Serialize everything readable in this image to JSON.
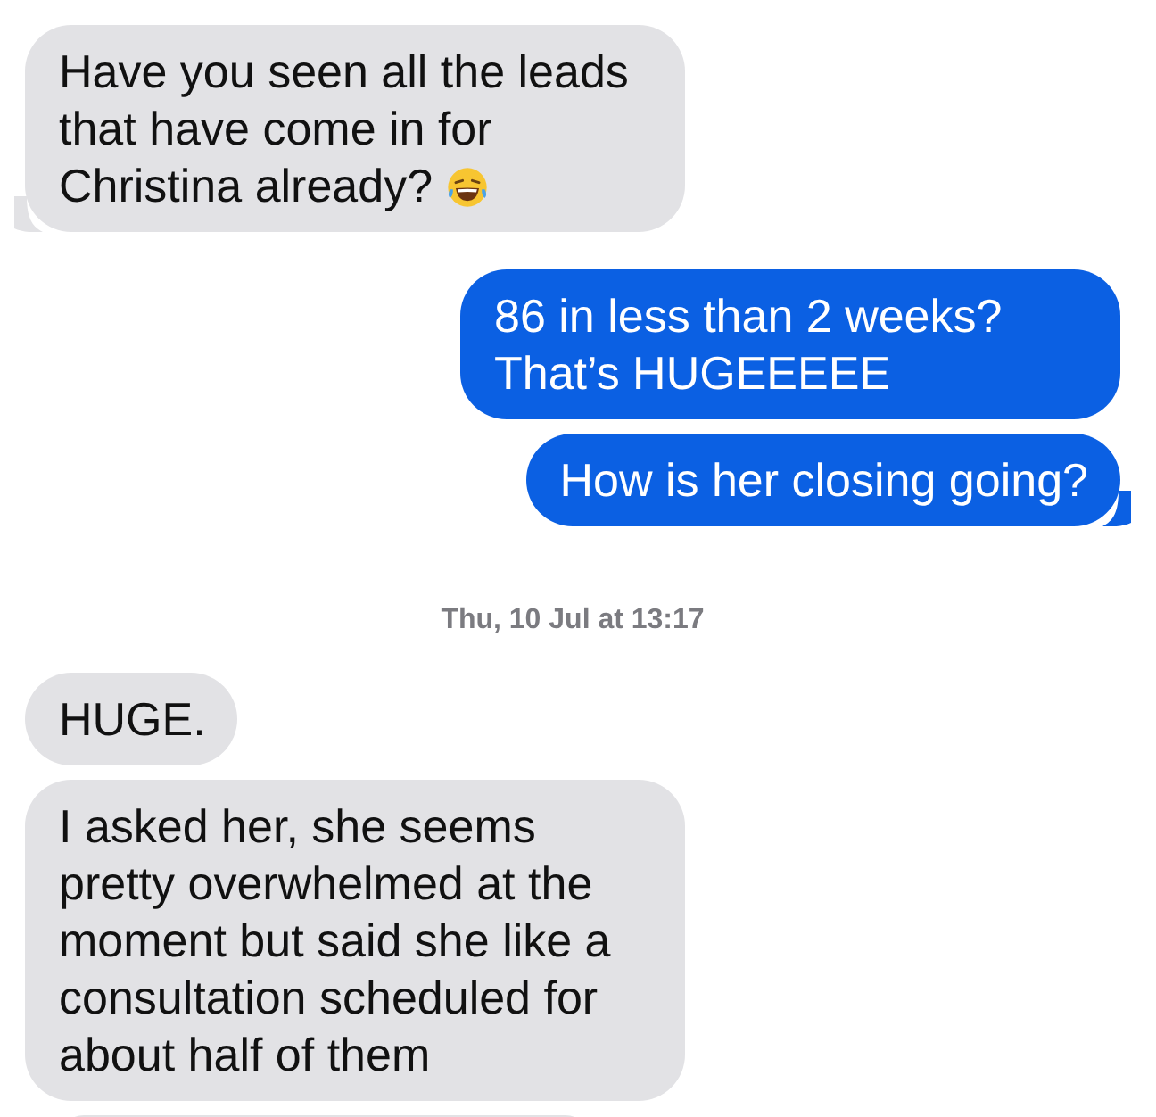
{
  "items": [
    {
      "kind": "message",
      "outgoing": false,
      "text": "Have you seen all the leads that have come in for Christina already?",
      "emoji": true,
      "tail": true
    },
    {
      "kind": "message",
      "outgoing": true,
      "text": "86 in less than 2 weeks? That’s HUGEEEEE",
      "emoji": false,
      "tail": false
    },
    {
      "kind": "message",
      "outgoing": true,
      "text": "How is her closing going?",
      "emoji": false,
      "tail": true
    },
    {
      "kind": "timestamp",
      "text": "Thu, 10 Jul at 13:17"
    },
    {
      "kind": "message",
      "outgoing": false,
      "text": "HUGE.",
      "emoji": false,
      "tail": false
    },
    {
      "kind": "message",
      "outgoing": false,
      "text": "I asked her, she seems pretty overwhelmed at the moment but said she like a consultation scheduled for about half of them",
      "emoji": false,
      "tail": false
    },
    {
      "kind": "cut_off",
      "outgoing": false
    }
  ]
}
